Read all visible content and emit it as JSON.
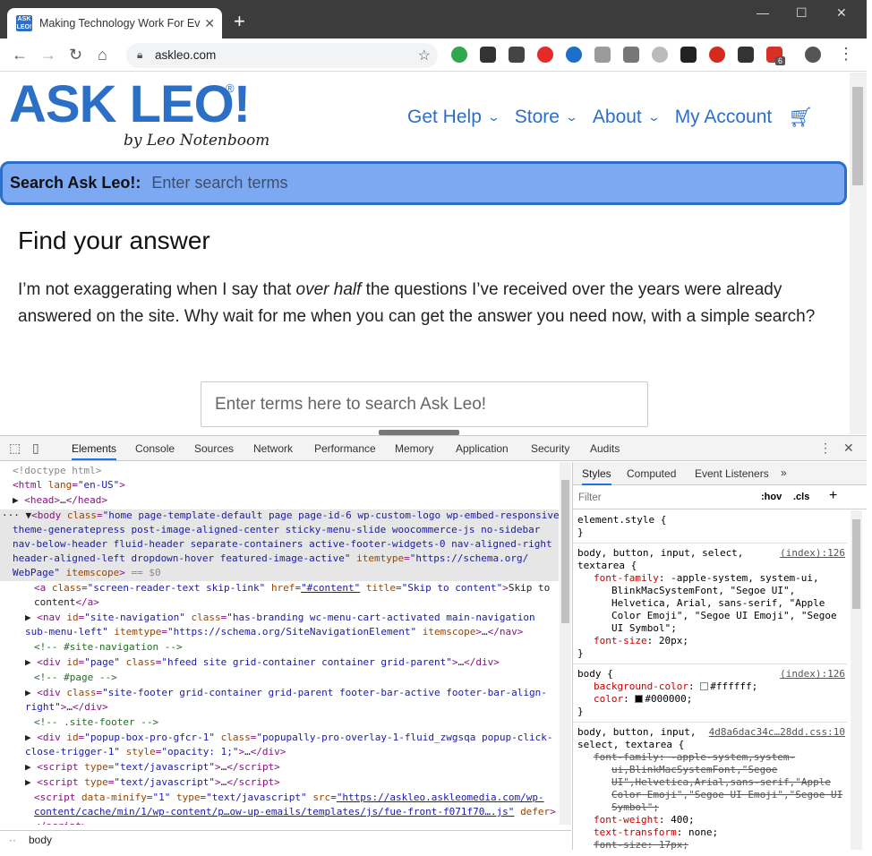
{
  "browser": {
    "tab_title": "Making Technology Work For Eve",
    "favicon_text": "ASK LEO!",
    "tab_close": "✕",
    "new_tab": "+",
    "url": "askleo.com",
    "ext_badge": "6"
  },
  "site": {
    "logo": "ASK LEO!",
    "logo_reg": "®",
    "logo_sub": "by Leo Notenboom",
    "nav": [
      "Get Help",
      "Store",
      "About",
      "My Account"
    ],
    "search_label": "Search Ask Leo!:",
    "search_placeholder": "Enter search terms",
    "heading": "Find your answer",
    "para_before": "I’m not exaggerating when I say that ",
    "para_em": "over half",
    "para_after": " the questions I’ve received over the years were already answered on the site. Why wait for me when you can get the answer you need now, with a simple search?",
    "big_search_placeholder": "Enter terms here to search Ask Leo!"
  },
  "devtools": {
    "tabs": [
      "Elements",
      "Console",
      "Sources",
      "Network",
      "Performance",
      "Memory",
      "Application",
      "Security",
      "Audits"
    ],
    "menu": "⋮",
    "close": "✕",
    "breadcrumb": "body",
    "styles_tabs": [
      "Styles",
      "Computed",
      "Event Listeners",
      "»"
    ],
    "filter_placeholder": "Filter",
    "hov": ":hov",
    "cls": ".cls",
    "add": "+",
    "rules": {
      "r0_selector": "element.style {",
      "r0_close": "}",
      "r1_selector": "body, button, input, select,",
      "r1_selector2": "textarea {",
      "r1_src": "(index):126",
      "r1_ff_name": "font-family",
      "r1_ff_val": "-apple-system, system-ui,",
      "r1_ff_val2": "BlinkMacSystemFont, \"Segoe UI\",",
      "r1_ff_val3": "Helvetica, Arial, sans-serif, \"Apple",
      "r1_ff_val4": "Color Emoji\", \"Segoe UI Emoji\", \"Segoe",
      "r1_ff_val5": "UI Symbol\";",
      "r1_fs_name": "font-size",
      "r1_fs_val": "20px;",
      "r2_selector": "body {",
      "r2_src": "(index):126",
      "r2_bg_name": "background-color",
      "r2_bg_val": "#ffffff;",
      "r2_c_name": "color",
      "r2_c_val": "#000000;",
      "r3_selector": "body, button, input,",
      "r3_selector2": "select, textarea {",
      "r3_src": "4d8a6dac34c…28dd.css:10",
      "r3_ff_line1": "font-family: -apple-system,system-",
      "r3_ff_line2": "ui,BlinkMacSystemFont,\"Segoe",
      "r3_ff_line3": "UI\",Helvetica,Arial,sans-serif,\"Apple",
      "r3_ff_line4": "Color Emoji\",\"Segoe UI Emoji\",\"Segoe UI",
      "r3_ff_line5": "Symbol\";",
      "r3_fw_name": "font-weight",
      "r3_fw_val": "400;",
      "r3_tt_name": "text-transform",
      "r3_tt_val": "none;",
      "r3_fs_line": "font-size: 17px;"
    }
  },
  "colors": {
    "brand_blue": "#2b6fc7",
    "search_bar_fill": "#7ca9f1",
    "devtools_accent": "#1a73e8"
  }
}
